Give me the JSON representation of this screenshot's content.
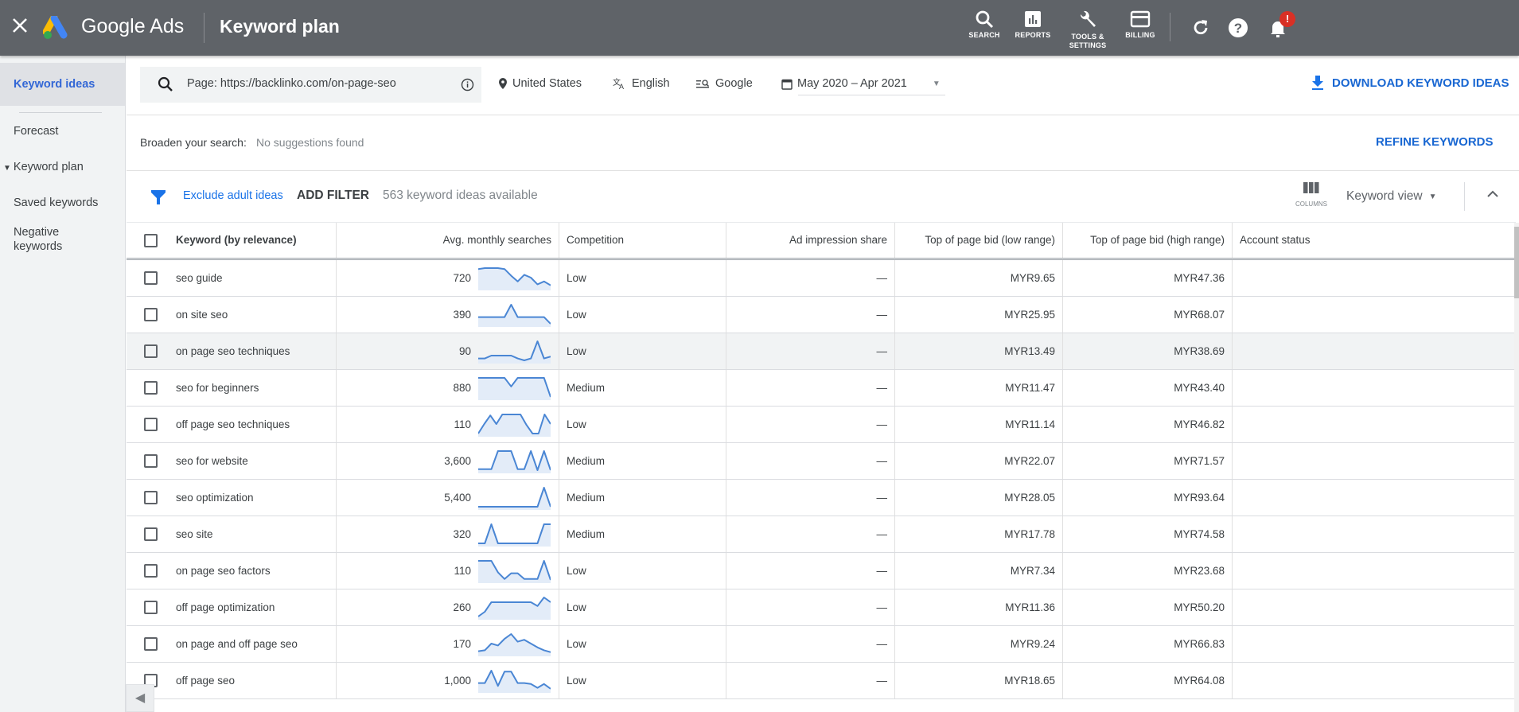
{
  "header": {
    "close_label": "×",
    "brand": "Google Ads",
    "title": "Keyword plan",
    "nav": [
      {
        "icon": "search-icon",
        "label": "SEARCH"
      },
      {
        "icon": "reports-icon",
        "label": "REPORTS"
      },
      {
        "icon": "wrench-icon",
        "label": "TOOLS &\nSETTINGS",
        "label_line1": "TOOLS &",
        "label_line2": "SETTINGS"
      },
      {
        "icon": "billing-icon",
        "label": "BILLING"
      }
    ],
    "notification_badge": "!"
  },
  "sidebar": {
    "items": [
      {
        "label": "Keyword ideas",
        "active": true
      },
      {
        "label": "Forecast"
      },
      {
        "label": "Keyword plan",
        "expandable": true
      },
      {
        "label": "Saved keywords"
      },
      {
        "label": "Negative keywords",
        "line1": "Negative",
        "line2": "keywords"
      }
    ],
    "collapse_glyph": "◀"
  },
  "search": {
    "query": "Page: https://backlinko.com/on-page-seo",
    "location": "United States",
    "language": "English",
    "network": "Google",
    "date_range": "May 2020 – Apr 2021",
    "download_label": "DOWNLOAD KEYWORD IDEAS"
  },
  "broaden": {
    "label": "Broaden your search:",
    "value": "No suggestions found",
    "refine_label": "REFINE KEYWORDS"
  },
  "filterbar": {
    "exclude_label": "Exclude adult ideas",
    "add_filter_label": "ADD FILTER",
    "count_text": "563 keyword ideas available",
    "columns_label": "COLUMNS",
    "view_label": "Keyword view"
  },
  "table": {
    "columns": [
      "Keyword (by relevance)",
      "Avg. monthly searches",
      "Competition",
      "Ad impression share",
      "Top of page bid (low range)",
      "Top of page bid (high range)",
      "Account status"
    ],
    "rows": [
      {
        "keyword": "seo guide",
        "searches": "720",
        "trend": [
          0.95,
          1,
          1,
          1,
          0.95,
          0.6,
          0.3,
          0.65,
          0.5,
          0.15,
          0.3,
          0.1
        ],
        "competition": "Low",
        "impression": "—",
        "bid_low": "MYR9.65",
        "bid_high": "MYR47.36",
        "status": ""
      },
      {
        "keyword": "on site seo",
        "searches": "390",
        "trend": [
          0.35,
          0.35,
          0.35,
          0.35,
          0.35,
          1,
          0.35,
          0.35,
          0.35,
          0.35,
          0.35,
          0
        ],
        "competition": "Low",
        "impression": "—",
        "bid_low": "MYR25.95",
        "bid_high": "MYR68.07",
        "status": ""
      },
      {
        "keyword": "on page seo techniques",
        "searches": "90",
        "trend": [
          0.1,
          0.1,
          0.25,
          0.25,
          0.25,
          0.25,
          0.1,
          0,
          0.1,
          1,
          0.1,
          0.2
        ],
        "competition": "Low",
        "impression": "—",
        "bid_low": "MYR13.49",
        "bid_high": "MYR38.69",
        "status": "",
        "highlighted": true
      },
      {
        "keyword": "seo for beginners",
        "searches": "880",
        "trend": [
          1,
          1,
          1,
          1,
          1,
          0.55,
          1,
          1,
          1,
          1,
          1,
          0
        ],
        "competition": "Medium",
        "impression": "—",
        "bid_low": "MYR11.47",
        "bid_high": "MYR43.40",
        "status": ""
      },
      {
        "keyword": "off page seo techniques",
        "searches": "110",
        "trend": [
          0,
          0.5,
          0.95,
          0.5,
          1,
          1,
          1,
          1,
          0.45,
          0,
          0,
          1,
          0.5
        ],
        "competition": "Low",
        "impression": "—",
        "bid_low": "MYR11.14",
        "bid_high": "MYR46.82",
        "status": ""
      },
      {
        "keyword": "seo for website",
        "searches": "3,600",
        "trend": [
          0.05,
          0.05,
          0.05,
          1,
          1,
          1,
          0.05,
          0.05,
          1,
          0,
          1,
          0
        ],
        "competition": "Medium",
        "impression": "—",
        "bid_low": "MYR22.07",
        "bid_high": "MYR71.57",
        "status": ""
      },
      {
        "keyword": "seo optimization",
        "searches": "5,400",
        "trend": [
          0,
          0,
          0,
          0,
          0,
          0,
          0,
          0,
          0,
          0,
          1,
          0
        ],
        "competition": "Medium",
        "impression": "—",
        "bid_low": "MYR28.05",
        "bid_high": "MYR93.64",
        "status": ""
      },
      {
        "keyword": "seo site",
        "searches": "320",
        "trend": [
          0,
          0,
          1,
          0,
          0,
          0,
          0,
          0,
          0,
          0,
          1,
          1
        ],
        "competition": "Medium",
        "impression": "—",
        "bid_low": "MYR17.78",
        "bid_high": "MYR74.58",
        "status": ""
      },
      {
        "keyword": "on page seo factors",
        "searches": "110",
        "trend": [
          1,
          1,
          1,
          0.4,
          0.05,
          0.35,
          0.35,
          0.05,
          0.05,
          0.05,
          1,
          0
        ],
        "competition": "Low",
        "impression": "—",
        "bid_low": "MYR7.34",
        "bid_high": "MYR23.68",
        "status": ""
      },
      {
        "keyword": "off page optimization",
        "searches": "260",
        "trend": [
          0,
          0.25,
          0.75,
          0.75,
          0.75,
          0.75,
          0.75,
          0.75,
          0.75,
          0.55,
          1,
          0.75
        ],
        "competition": "Low",
        "impression": "—",
        "bid_low": "MYR11.36",
        "bid_high": "MYR50.20",
        "status": ""
      },
      {
        "keyword": "on page and off page seo",
        "searches": "170",
        "trend": [
          0.1,
          0.15,
          0.5,
          0.4,
          0.75,
          1,
          0.6,
          0.7,
          0.5,
          0.3,
          0.15,
          0.05
        ],
        "competition": "Low",
        "impression": "—",
        "bid_low": "MYR9.24",
        "bid_high": "MYR66.83",
        "status": ""
      },
      {
        "keyword": "off page seo",
        "searches": "1,000",
        "trend": [
          0.35,
          0.35,
          1,
          0.2,
          0.95,
          0.95,
          0.35,
          0.35,
          0.3,
          0.1,
          0.3,
          0.05
        ],
        "competition": "Low",
        "impression": "—",
        "bid_low": "MYR18.65",
        "bid_high": "MYR64.08",
        "status": ""
      }
    ]
  },
  "colors": {
    "header_bg": "#5f6368",
    "accent_blue": "#1a73e8",
    "spark_line": "#4a86d4",
    "spark_fill": "#e3ecf8",
    "badge_red": "#d93025"
  }
}
